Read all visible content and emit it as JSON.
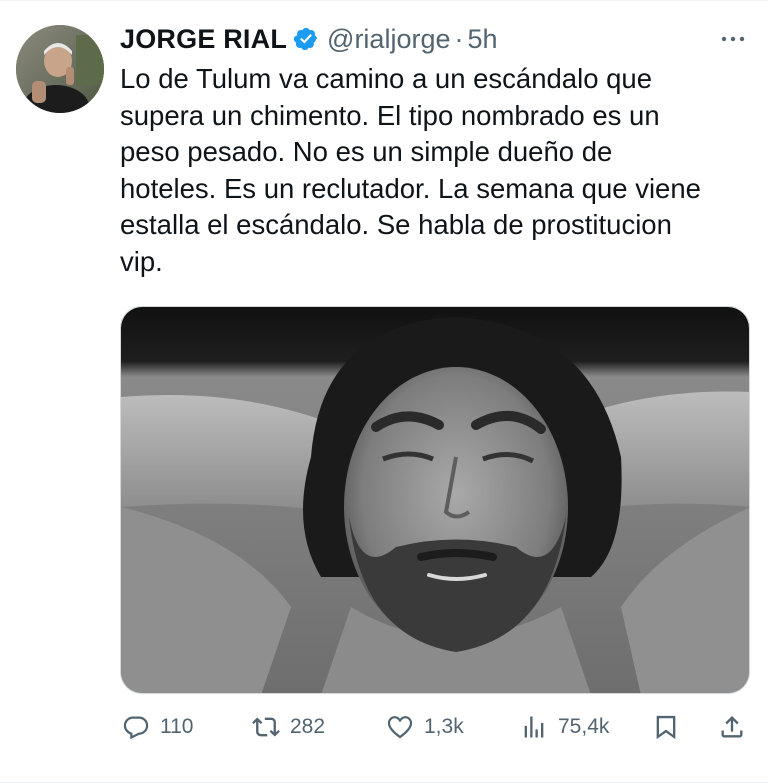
{
  "tweet": {
    "author": {
      "display_name": "JORGE RIAL",
      "handle": "@rialjorge",
      "verified": true,
      "avatar": "profile-photo"
    },
    "separator": "·",
    "time": "5h",
    "more_icon": "more-horizontal-icon",
    "text": "Lo de Tulum va camino a un escándalo que\nsupera un chimento. El tipo nombrado es un\npeso pesado. No es un simple dueño de\nhoteles. Es un reclutador. La semana que viene\nestalla el escándalo. Se habla de prostitucion\nvip.",
    "media": {
      "type": "photo",
      "style": "black-and-white",
      "subject": "man-with-hands-behind-head"
    },
    "actions": {
      "reply": {
        "icon": "reply-icon",
        "count": "110"
      },
      "retweet": {
        "icon": "retweet-icon",
        "count": "282"
      },
      "like": {
        "icon": "heart-icon",
        "count": "1,3k"
      },
      "views": {
        "icon": "views-icon",
        "count": "75,4k"
      },
      "bookmark": {
        "icon": "bookmark-icon"
      },
      "share": {
        "icon": "share-icon"
      }
    }
  },
  "colors": {
    "text_primary": "#0f1419",
    "text_secondary": "#536471",
    "verified_blue": "#1d9bf0",
    "border": "#eff3f4"
  }
}
